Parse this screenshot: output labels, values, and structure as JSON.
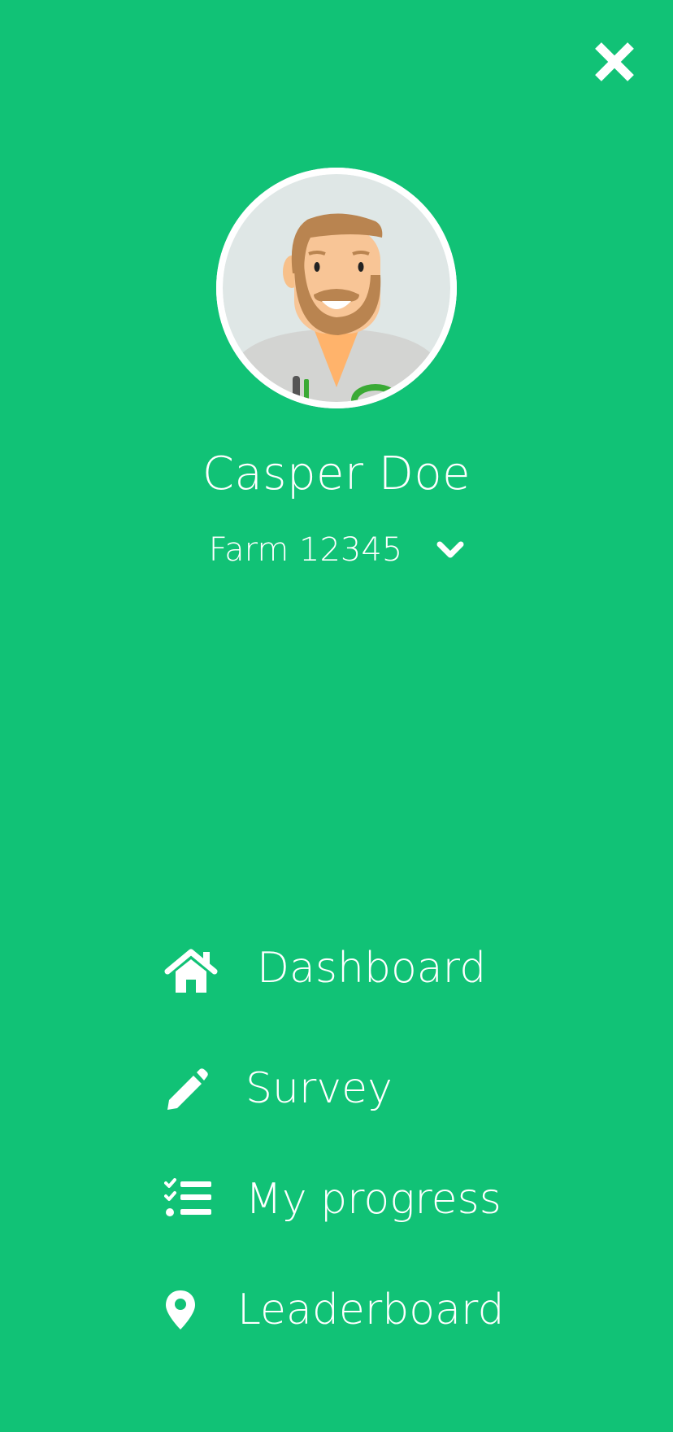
{
  "colors": {
    "background": "#11c276",
    "foreground": "#ffffff"
  },
  "header": {
    "close_icon": "close-icon"
  },
  "profile": {
    "name": "Casper Doe",
    "farm_label": "Farm 12345",
    "farm_dropdown_icon": "chevron-down-icon",
    "avatar_icon": "avatar"
  },
  "nav": {
    "items": [
      {
        "label": "Dashboard",
        "icon": "home-icon"
      },
      {
        "label": "Survey",
        "icon": "pencil-icon"
      },
      {
        "label": "My progress",
        "icon": "checklist-icon"
      },
      {
        "label": "Leaderboard",
        "icon": "map-marker-icon"
      }
    ]
  }
}
